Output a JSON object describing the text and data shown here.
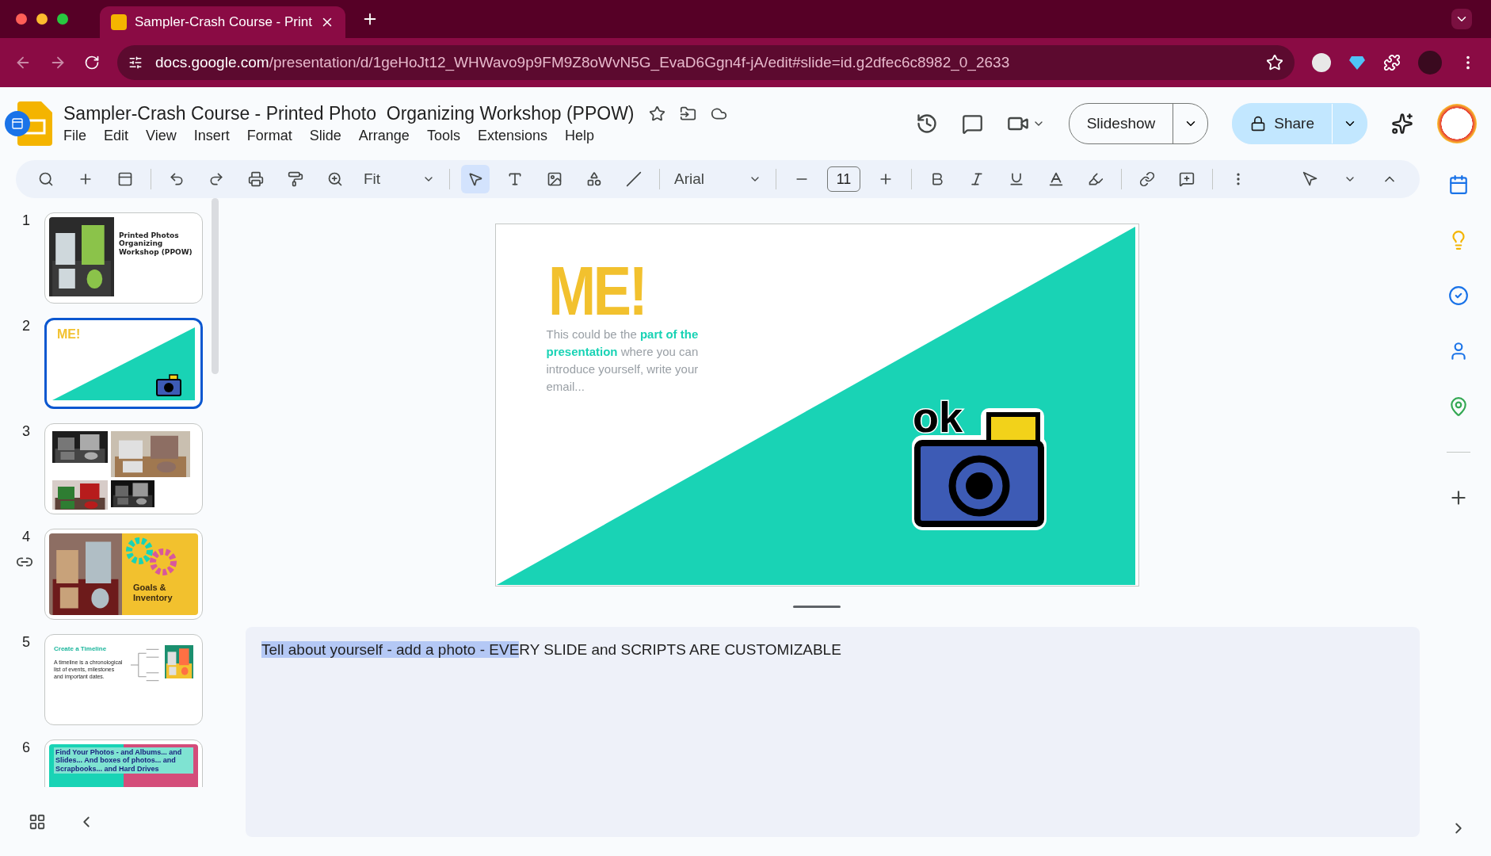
{
  "browser": {
    "tabs": [
      {
        "title": "Sampler-Crash Course - Print",
        "selected": true
      }
    ],
    "url": {
      "host": "docs.google.com",
      "path": "/presentation/d/1geHoJt12_WHWavo9p9FM9Z8oWvN5G_EvaD6Ggn4f-jA/edit#slide=id.g2dfec6c8982_0_2633"
    }
  },
  "document": {
    "title": "Sampler-Crash Course - Printed Photo  Organizing Workshop (PPOW)",
    "menus": [
      "File",
      "Edit",
      "View",
      "Insert",
      "Format",
      "Slide",
      "Arrange",
      "Tools",
      "Extensions",
      "Help"
    ],
    "slideshow_button": "Slideshow",
    "share_button": "Share"
  },
  "toolbar": {
    "zoom": "Fit",
    "font": "Arial",
    "font_size": "11"
  },
  "slides": [
    {
      "number": "1",
      "kind": "title",
      "selected": false,
      "title": "Printed Photos Organizing Workshop (PPOW)"
    },
    {
      "number": "2",
      "kind": "me",
      "selected": true,
      "title": "ME!"
    },
    {
      "number": "3",
      "kind": "photos",
      "selected": false
    },
    {
      "number": "4",
      "kind": "goals",
      "selected": false,
      "title": "Goals & Inventory"
    },
    {
      "number": "5",
      "kind": "timeline",
      "selected": false,
      "title": "Create a Timeline",
      "body": "A timeline is a chronological list of events, milestones and important dates."
    },
    {
      "number": "6",
      "kind": "find",
      "selected": false,
      "title": "Find Your Photos - and Albums... and Slides... And boxes of photos... and Scrapbooks... and Hard Drives"
    }
  ],
  "current_slide": {
    "heading": "ME!",
    "body": "This could be the **part of the presentation** where you can introduce yourself, write your email...",
    "sticker_text": "ok"
  },
  "speaker_notes": [
    {
      "text": "Tell about yourself - add a photo - EVE",
      "selected": true
    },
    {
      "text": "RY SLIDE and SCRIPTS ARE CUSTOMIZABLE",
      "selected": false
    }
  ]
}
